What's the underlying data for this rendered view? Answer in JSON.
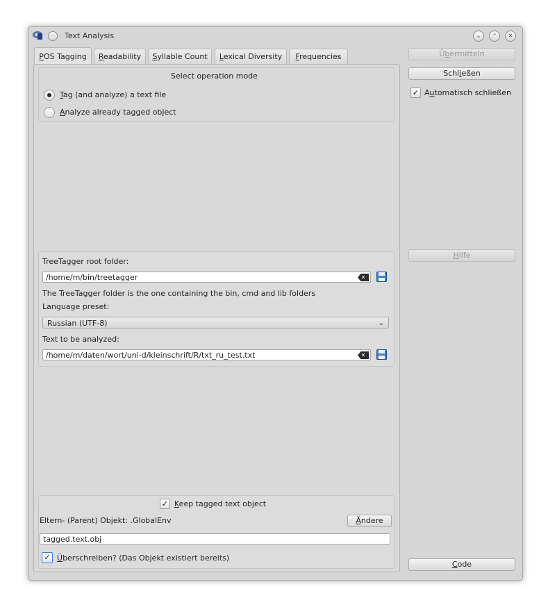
{
  "window": {
    "title": "Text Analysis",
    "controls": {
      "minimize": "⌄",
      "maximize": "⌃",
      "close": "✕"
    }
  },
  "tabs": [
    {
      "label": "POS Tagging",
      "mnemonic": "P",
      "rest": "OS Tagging"
    },
    {
      "label": "Readability",
      "mnemonic": "R",
      "rest": "eadability"
    },
    {
      "label": "Syllable Count",
      "mnemonic": "S",
      "rest": "yllable Count"
    },
    {
      "label": "Lexical Diversity",
      "mnemonic": "L",
      "rest": "exical Diversity"
    },
    {
      "label": "Frequencies",
      "mnemonic": "F",
      "rest": "requencies"
    }
  ],
  "mode": {
    "heading": "Select operation mode",
    "option1": {
      "mn": "T",
      "rest": "ag (and analyze) a text file",
      "selected": true
    },
    "option2": {
      "mn": "A",
      "rest": "nalyze already tagged object",
      "selected": false
    }
  },
  "treetagger": {
    "root_label": "TreeTagger root folder:",
    "root_value": "/home/m/bin/treetagger",
    "root_hint": "The TreeTagger folder is the one containing the bin, cmd and lib folders",
    "lang_label": "Language preset:",
    "lang_value": "Russian (UTF-8)",
    "text_label": "Text to be analyzed:",
    "text_value": "/home/m/daten/wort/uni-d/kleinschrift/R/txt_ru_test.txt"
  },
  "keep": {
    "checkbox_mn": "K",
    "checkbox_rest": "eep tagged text object",
    "checked": true,
    "parent_label": "Eltern- (Parent) Objekt: .GlobalEnv",
    "change_mn": "Ä",
    "change_rest": "ndere",
    "object_name": "tagged.text.obj",
    "overwrite_mn": "Ü",
    "overwrite_rest": "berschreiben? (Das Objekt existiert bereits)",
    "overwrite_checked": true
  },
  "sidebar": {
    "submit_pre": "Ü",
    "submit_mn": "b",
    "submit_rest": "ermitteln",
    "close_pre": "Schl",
    "close_mn": "i",
    "close_rest": "eßen",
    "autoclose_pre": "A",
    "autoclose_mn": "u",
    "autoclose_rest": "tomatisch schließen",
    "autoclose_checked": true,
    "help_mn": "H",
    "help_rest": "ilfe",
    "code_mn": "C",
    "code_rest": "ode"
  },
  "icons": {
    "app": "r-logo-icon",
    "pin": "pin-icon",
    "clear": "clear-text-icon",
    "save": "save-icon",
    "dropdown": "chevron-down-icon"
  },
  "colors": {
    "window_bg": "#d6d6d6",
    "accent_save": "#3b7fd1"
  }
}
